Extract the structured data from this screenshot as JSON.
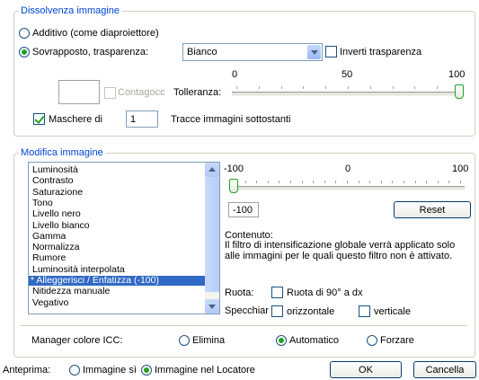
{
  "dissolve": {
    "legend": "Dissolvenza immagine",
    "additive_label": "Additivo (come diaproiettore)",
    "overlay_label": "Sovrapposto, trasparenza:",
    "transparency_value": "Bianco",
    "invert_label": "Inverti trasparenza",
    "eyedropper_label": "Contagocc",
    "tolerance_label": "Tolleranza:",
    "scale": [
      "0",
      "50",
      "100"
    ],
    "tolerance_value": 100,
    "masks_label": "Maschere di",
    "masks_value": "1",
    "traces_label": "Tracce immagini sottostanti"
  },
  "modify": {
    "legend": "Modifica immagine",
    "filters": [
      "Luminosità",
      "Contrasto",
      "Saturazione",
      "Tono",
      "Livello nero",
      "Livello bianco",
      "Gamma",
      "Normalizza",
      "Rumore",
      "Luminosità interpolata",
      "* Alleggerisci / Enfatizza (-100)",
      "Nitidezza manuale",
      "Vegativo"
    ],
    "selected_index": 10,
    "scale": [
      "-100",
      "0",
      "100"
    ],
    "slider_value": -100,
    "value_field": "-100",
    "reset_label": "Reset",
    "content_title": "Contenuto:",
    "content_text": "Il filtro di intensificazione globale verrà applicato solo alle immagini per le quali questo filtro non è attivato.",
    "rotate_label": "Ruota:",
    "rotate_90_label": "Ruota di 90° a dx",
    "mirror_label": "Specchiar",
    "horizontal_label": "orizzontale",
    "vertical_label": "verticale"
  },
  "icc": {
    "label": "Manager colore ICC:",
    "remove_label": "Elimina",
    "auto_label": "Automatico",
    "force_label": "Forzare"
  },
  "footer": {
    "preview_label": "Anteprima:",
    "image_yes_label": "Immagine sì",
    "image_locator_label": "Immagine nel Locatore",
    "ok_label": "OK",
    "cancel_label": "Cancella"
  }
}
